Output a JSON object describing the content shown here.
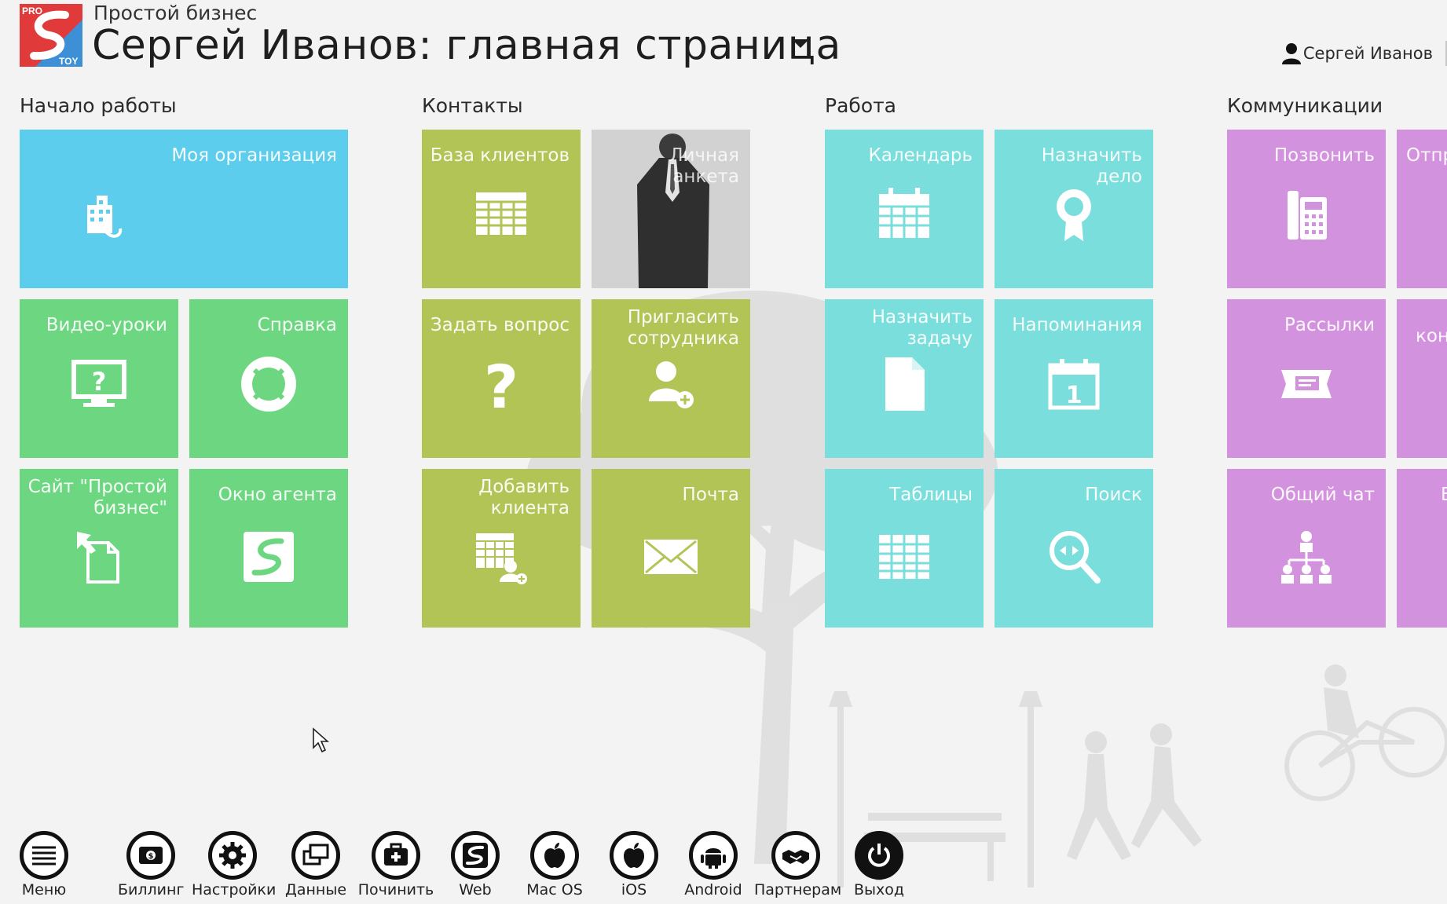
{
  "header": {
    "app_name": "Простой бизнес",
    "page_title": "Сергей Иванов: главная страница",
    "user_name": "Сергей Иванов",
    "logo_text_top": "PRO",
    "logo_text_bottom": "TOY"
  },
  "groups": [
    {
      "title": "Начало работы",
      "color": "#5ccdec",
      "tiles": [
        {
          "label": "Моя организация",
          "icon": "building-icon"
        },
        {
          "label": "Видео-уроки",
          "icon": "monitor-question-icon"
        },
        {
          "label": "Справка",
          "icon": "lifebuoy-icon"
        },
        {
          "label": "Сайт \"Простой\nбизнес\"",
          "icon": "file-arrow-icon"
        },
        {
          "label": "Окно агента",
          "icon": "agent-logo-icon"
        }
      ]
    },
    {
      "title": "Контакты",
      "color": "#b3c457",
      "tiles": [
        {
          "label": "База клиентов",
          "icon": "table-icon"
        },
        {
          "label": "Личная анкета",
          "icon": "profile-photo"
        },
        {
          "label": "Задать вопрос",
          "icon": "question-icon"
        },
        {
          "label": "Пригласить\nсотрудника",
          "icon": "add-user-icon"
        },
        {
          "label": "Добавить\nклиента",
          "icon": "add-client-icon"
        },
        {
          "label": "Почта",
          "icon": "envelope-icon"
        }
      ]
    },
    {
      "title": "Работа",
      "color": "#7adfdc",
      "tiles": [
        {
          "label": "Календарь",
          "icon": "calendar-icon"
        },
        {
          "label": "Назначить дело",
          "icon": "award-icon"
        },
        {
          "label": "Назначить\nзадачу",
          "icon": "document-icon"
        },
        {
          "label": "Напоминания",
          "icon": "calendar-one-icon"
        },
        {
          "label": "Таблицы",
          "icon": "grid-icon"
        },
        {
          "label": "Поиск",
          "icon": "search-icon"
        }
      ]
    },
    {
      "title": "Коммуникации",
      "color": "#d392dd",
      "tiles": [
        {
          "label": "Позвонить",
          "icon": "phone-icon"
        },
        {
          "label": "Отпр",
          "icon": ""
        },
        {
          "label": "Рассылки",
          "icon": "mailing-icon"
        },
        {
          "label": "кон",
          "icon": ""
        },
        {
          "label": "Общий чат",
          "icon": "group-chat-icon"
        },
        {
          "label": "Е",
          "icon": ""
        }
      ]
    }
  ],
  "toolbar": [
    {
      "label": "Меню",
      "icon": "menu-icon"
    },
    {
      "label": "Биллинг",
      "icon": "billing-icon"
    },
    {
      "label": "Настройки",
      "icon": "gear-icon"
    },
    {
      "label": "Данные",
      "icon": "data-icon"
    },
    {
      "label": "Починить",
      "icon": "repair-kit-icon"
    },
    {
      "label": "Web",
      "icon": "web-logo-icon"
    },
    {
      "label": "Mac OS",
      "icon": "apple-icon"
    },
    {
      "label": "iOS",
      "icon": "apple-icon"
    },
    {
      "label": "Android",
      "icon": "android-icon"
    },
    {
      "label": "Партнерам",
      "icon": "handshake-icon"
    },
    {
      "label": "Выход",
      "icon": "power-icon"
    }
  ]
}
